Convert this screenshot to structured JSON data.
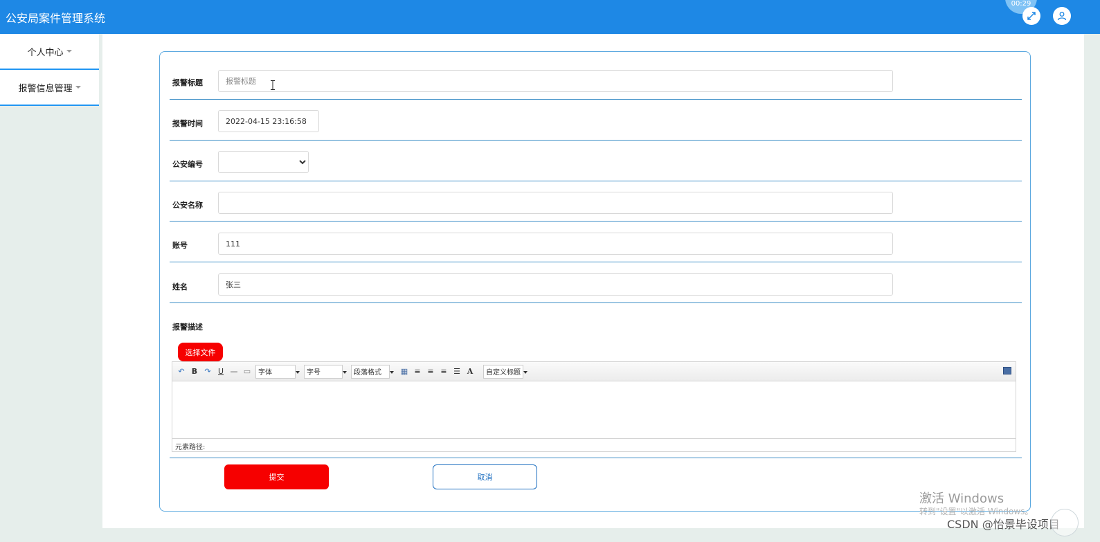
{
  "header": {
    "title": "公安局案件管理系统",
    "timer_text": "00:29"
  },
  "sidebar": {
    "items": [
      {
        "label": "个人中心"
      },
      {
        "label": "报警信息管理"
      }
    ]
  },
  "form": {
    "title_label": "报警标题",
    "title_placeholder": "报警标题",
    "title_value": "",
    "time_label": "报警时间",
    "time_value": "2022-04-15 23:16:58",
    "police_no_label": "公安编号",
    "police_no_value": "",
    "police_name_label": "公安名称",
    "police_name_value": "",
    "account_label": "账号",
    "account_value": "111",
    "name_label": "姓名",
    "name_value": "张三",
    "desc_label": "报警描述"
  },
  "editor": {
    "upload_label": "选择文件",
    "font_label": "字体",
    "size_label": "字号",
    "paragraph_label": "段落格式",
    "custom_title_label": "自定义标题",
    "path_label": "元素路径:"
  },
  "actions": {
    "submit_label": "提交",
    "cancel_label": "取消"
  },
  "watermark": {
    "line1": "激活 Windows",
    "line2": "转到\"设置\"以激活 Windows。",
    "line3": "CSDN @怡景毕设项目"
  },
  "colors": {
    "primary": "#1e88e5",
    "danger": "#f60000",
    "border_accent": "#3e8fc7"
  }
}
